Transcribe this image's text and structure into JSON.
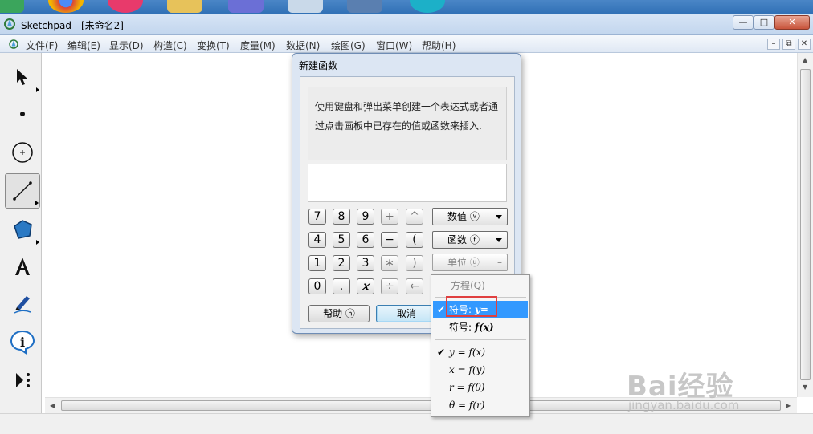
{
  "window": {
    "title": "Sketchpad  - [未命名2]",
    "min_glyph": "—",
    "max_glyph": "□",
    "close_glyph": "✕"
  },
  "menu": {
    "items": [
      "文件(F)",
      "编辑(E)",
      "显示(D)",
      "构造(C)",
      "变换(T)",
      "度量(M)",
      "数据(N)",
      "绘图(G)",
      "窗口(W)",
      "帮助(H)"
    ],
    "mdi_min": "–",
    "mdi_restore": "⧉",
    "mdi_close": "✕"
  },
  "toolbar": {
    "tools": [
      "arrow-tool",
      "point-tool",
      "compass-tool",
      "straightedge-tool",
      "polygon-tool",
      "text-tool",
      "marker-tool",
      "information-tool",
      "custom-tool"
    ],
    "active": "straightedge-tool"
  },
  "dialog": {
    "title": "新建函数",
    "instruction_line1": "使用键盘和弹出菜单创建一个表达式或者通",
    "instruction_line2": "过点击画板中已存在的值或函数来插入.",
    "expression": "",
    "keys": {
      "k7": "7",
      "k8": "8",
      "k9": "9",
      "plus": "+",
      "caret": "^",
      "k4": "4",
      "k5": "5",
      "k6": "6",
      "minus": "−",
      "lparen": "(",
      "k1": "1",
      "k2": "2",
      "k3": "3",
      "times": "∗",
      "rparen": ")",
      "k0": "0",
      "dot": ".",
      "x": "𝑥",
      "divide": "÷",
      "backspace": "←"
    },
    "dropdowns": {
      "values": "数值 ⓥ",
      "functions": "函数 ⓕ",
      "units": "单位 ⓤ"
    },
    "help_button": "帮助 ⓗ",
    "cancel_button": "取消"
  },
  "popup_menu": {
    "equation": "方程(Q)",
    "symbol_y": "符号:",
    "symbol_y_value": "y=",
    "symbol_f": "符号:",
    "symbol_f_value": "f(x)",
    "check_glyph": "✔",
    "forms": [
      "y = f(x)",
      "x = f(y)",
      "r = f(θ)",
      "θ = f(r)"
    ],
    "checked_form_index": 0,
    "selected": "symbol_y"
  },
  "watermark": {
    "main": "Bai经验",
    "sub": "jingyan.baidu.com"
  },
  "colors": {
    "selection": "#3399ff",
    "highlight_box": "#e04040",
    "titlebar": "#c2d6ee"
  }
}
